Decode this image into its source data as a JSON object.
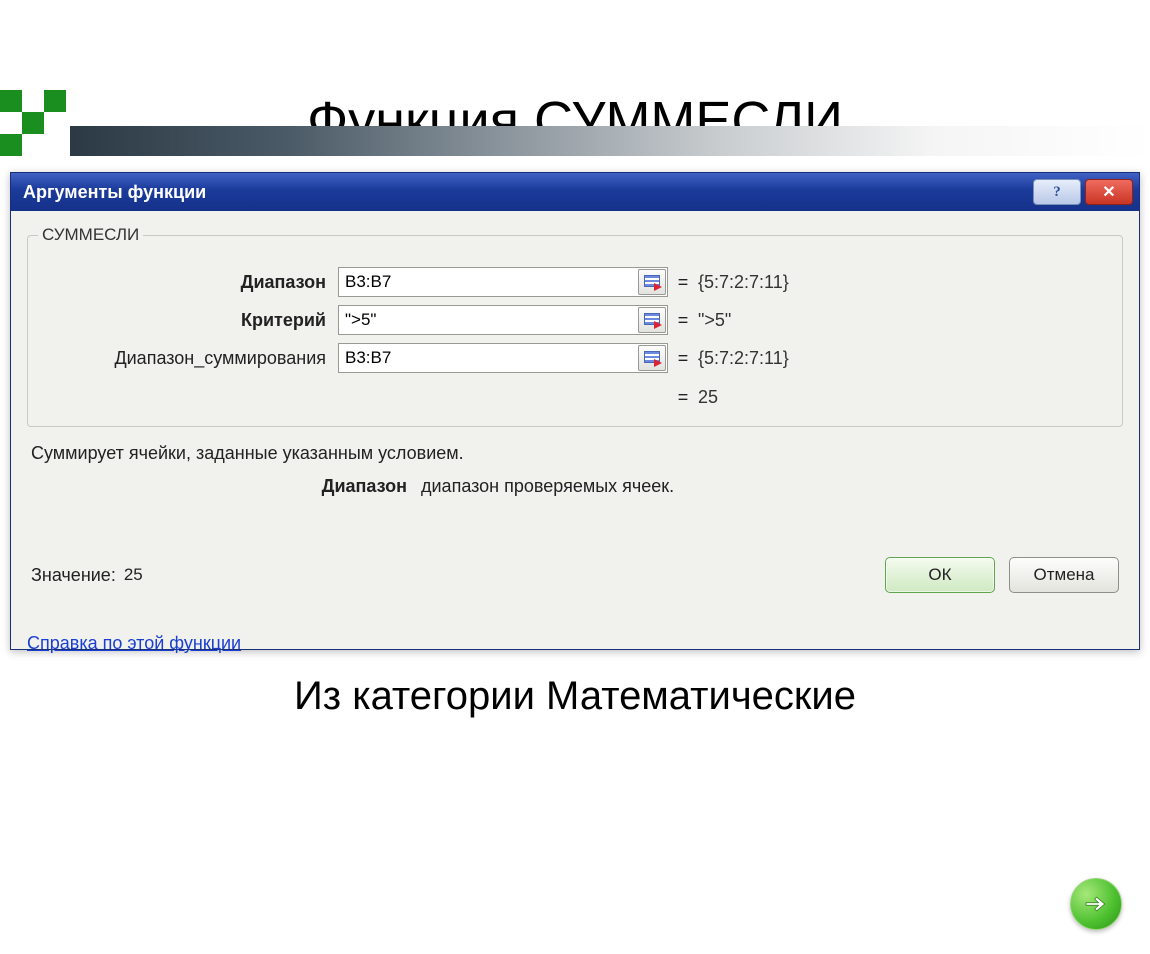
{
  "page": {
    "title": "Функция СУММЕСЛИ",
    "caption": "Из категории Математические"
  },
  "dialog": {
    "title": "Аргументы функции",
    "function_name": "СУММЕСЛИ",
    "args": [
      {
        "label": "Диапазон",
        "bold": true,
        "value": "B3:B7",
        "result": "{5:7:2:7:11}"
      },
      {
        "label": "Критерий",
        "bold": true,
        "value": "\">5\"",
        "result": "\">5\""
      },
      {
        "label": "Диапазон_суммирования",
        "bold": false,
        "value": "B3:B7",
        "result": "{5:7:2:7:11}"
      }
    ],
    "overall_result": "25",
    "description": "Суммирует ячейки, заданные указанным условием.",
    "param": {
      "name": "Диапазон",
      "desc": "диапазон проверяемых ячеек."
    },
    "value_label": "Значение:",
    "value": "25",
    "help_link": "Справка по этой функции",
    "ok": "ОК",
    "cancel": "Отмена",
    "help_btn": "?",
    "close_btn": "✕"
  }
}
